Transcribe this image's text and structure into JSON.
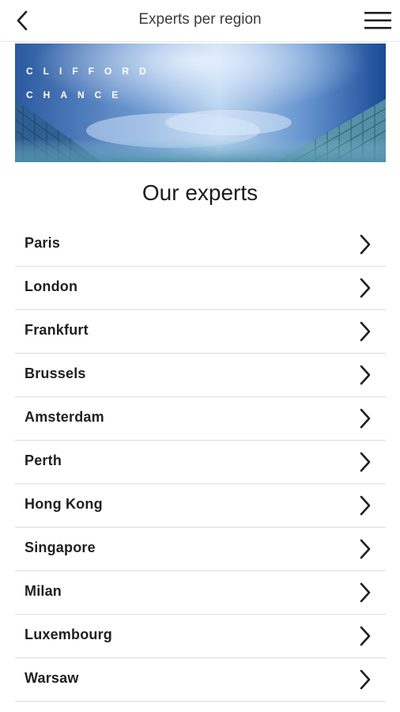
{
  "header": {
    "title": "Experts per region",
    "back_icon": "chevron-left-icon",
    "menu_icon": "hamburger-menu-icon"
  },
  "banner": {
    "logo_line1": "CLIFFORD",
    "logo_line2": "CHANCE"
  },
  "main": {
    "heading": "Our experts",
    "regions": [
      {
        "label": "Paris"
      },
      {
        "label": "London"
      },
      {
        "label": "Frankfurt"
      },
      {
        "label": "Brussels"
      },
      {
        "label": "Amsterdam"
      },
      {
        "label": "Perth"
      },
      {
        "label": "Hong Kong"
      },
      {
        "label": "Singapore"
      },
      {
        "label": "Milan"
      },
      {
        "label": "Luxembourg"
      },
      {
        "label": "Warsaw"
      }
    ],
    "row_icon": "chevron-right-icon"
  },
  "colors": {
    "banner_dark": "#1f4f9a",
    "banner_light": "#a7c8ec",
    "divider": "#dcdcdc",
    "text": "#202020"
  }
}
